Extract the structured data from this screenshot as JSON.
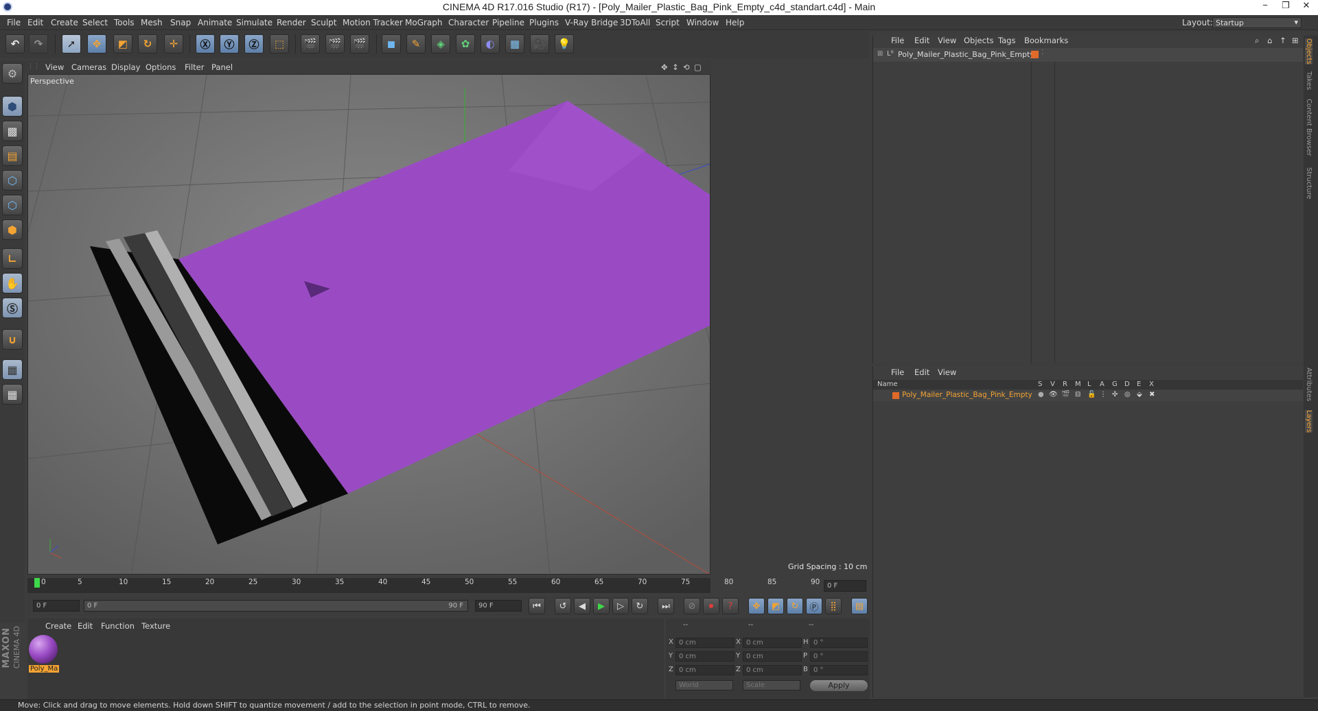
{
  "window": {
    "title": "CINEMA 4D R17.016 Studio (R17) - [Poly_Mailer_Plastic_Bag_Pink_Empty_c4d_standart.c4d] - Main",
    "controls": [
      "−",
      "❐",
      "✕"
    ]
  },
  "menubar": {
    "items": [
      "File",
      "Edit",
      "Create",
      "Select",
      "Tools",
      "Mesh",
      "Snap",
      "Animate",
      "Simulate",
      "Render",
      "Sculpt",
      "Motion Tracker",
      "MoGraph",
      "Character",
      "Pipeline",
      "Plugins",
      "V-Ray Bridge",
      "3DToAll",
      "Script",
      "Window",
      "Help"
    ],
    "layout_label": "Layout:",
    "layout_value": "Startup"
  },
  "viewport": {
    "menu": [
      "View",
      "Cameras",
      "Display",
      "Options",
      "Filter",
      "Panel"
    ],
    "label": "Perspective",
    "grid_spacing": "Grid Spacing : 10 cm",
    "bag_color": "#9a4bc4",
    "seal_color": "#0a0a0a"
  },
  "timeline": {
    "ticks": [
      "0",
      "5",
      "10",
      "15",
      "20",
      "25",
      "30",
      "35",
      "40",
      "45",
      "50",
      "55",
      "60",
      "65",
      "70",
      "75",
      "80",
      "85",
      "90"
    ],
    "end_field": "0 F",
    "start_frame": "0 F",
    "range_start": "0 F",
    "range_end": "90 F",
    "max_frame": "90 F"
  },
  "material_panel": {
    "menu": [
      "Create",
      "Edit",
      "Function",
      "Texture"
    ],
    "material_name": "Poly_Ma"
  },
  "coordinates": {
    "header": [
      "--",
      "--",
      "--"
    ],
    "rows": [
      {
        "a": "X",
        "av": "0 cm",
        "b": "X",
        "bv": "0 cm",
        "c": "H",
        "cv": "0 °"
      },
      {
        "a": "Y",
        "av": "0 cm",
        "b": "Y",
        "bv": "0 cm",
        "c": "P",
        "cv": "0 °"
      },
      {
        "a": "Z",
        "av": "0 cm",
        "b": "Z",
        "bv": "0 cm",
        "c": "B",
        "cv": "0 °"
      }
    ],
    "world": "World",
    "scale": "Scale",
    "apply": "Apply"
  },
  "objects_panel": {
    "menu": [
      "File",
      "Edit",
      "View",
      "Objects",
      "Tags",
      "Bookmarks"
    ],
    "object_name": "Poly_Mailer_Plastic_Bag_Pink_Empty"
  },
  "layers_panel": {
    "menu": [
      "File",
      "Edit",
      "View"
    ],
    "name_header": "Name",
    "columns": [
      "S",
      "V",
      "R",
      "M",
      "L",
      "A",
      "G",
      "D",
      "E",
      "X"
    ],
    "layer_name": "Poly_Mailer_Plastic_Bag_Pink_Empty"
  },
  "side_tabs": [
    "Objects",
    "Takes",
    "Content Browser",
    "Structure",
    "Attributes",
    "Layers"
  ],
  "status": "Move: Click and drag to move elements. Hold down SHIFT to quantize movement / add to the selection in point mode, CTRL to remove.",
  "brand": [
    "MAXON",
    "CINEMA 4D"
  ]
}
